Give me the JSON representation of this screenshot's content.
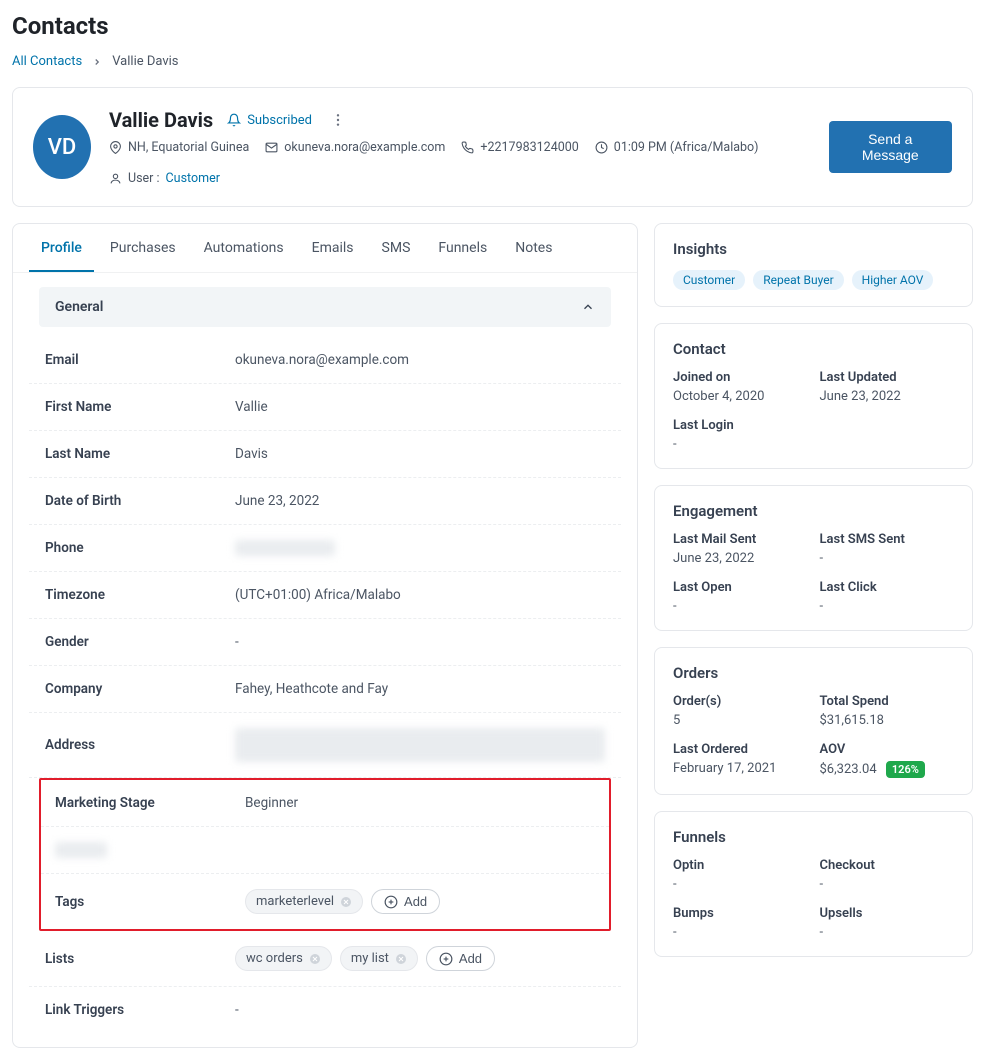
{
  "page_title": "Contacts",
  "breadcrumbs": {
    "all": "All Contacts",
    "current": "Vallie Davis"
  },
  "header": {
    "initials": "VD",
    "name": "Vallie Davis",
    "subscribe_label": "Subscribed",
    "location": "NH, Equatorial Guinea",
    "email": "okuneva.nora@example.com",
    "phone": "+2217983124000",
    "time": "01:09 PM (Africa/Malabo)",
    "user_prefix": "User :",
    "user_link": "Customer",
    "send_button": "Send a Message"
  },
  "tabs": [
    "Profile",
    "Purchases",
    "Automations",
    "Emails",
    "SMS",
    "Funnels",
    "Notes"
  ],
  "general": {
    "title": "General",
    "email_label": "Email",
    "email_value": "okuneva.nora@example.com",
    "first_name_label": "First Name",
    "first_name_value": "Vallie",
    "last_name_label": "Last Name",
    "last_name_value": "Davis",
    "dob_label": "Date of Birth",
    "dob_value": "June 23, 2022",
    "phone_label": "Phone",
    "phone_value": "+2217983124000",
    "timezone_label": "Timezone",
    "timezone_value": "(UTC+01:00) Africa/Malabo",
    "gender_label": "Gender",
    "gender_value": "-",
    "company_label": "Company",
    "company_value": "Fahey, Heathcote and Fay",
    "address_label": "Address",
    "address_value": "redacted",
    "marketing_label": "Marketing Stage",
    "marketing_value": "Beginner",
    "hidden_label": "redacted",
    "tags_label": "Tags",
    "tag_add": "Add",
    "tags": [
      "marketerlevel"
    ],
    "lists_label": "Lists",
    "lists": [
      "wc orders",
      "my list"
    ],
    "link_triggers_label": "Link Triggers",
    "link_triggers_value": "-"
  },
  "insights": {
    "title": "Insights",
    "badges": [
      "Customer",
      "Repeat Buyer",
      "Higher AOV"
    ]
  },
  "contact_info": {
    "title": "Contact",
    "joined_label": "Joined on",
    "joined_value": "October 4, 2020",
    "last_updated_label": "Last Updated",
    "last_updated_value": "June 23, 2022",
    "last_login_label": "Last Login",
    "last_login_value": "-"
  },
  "engagement": {
    "title": "Engagement",
    "mail_sent_label": "Last Mail Sent",
    "mail_sent_value": "June 23, 2022",
    "sms_sent_label": "Last SMS Sent",
    "sms_sent_value": "-",
    "last_open_label": "Last Open",
    "last_open_value": "-",
    "last_click_label": "Last Click",
    "last_click_value": "-"
  },
  "orders": {
    "title": "Orders",
    "orders_label": "Order(s)",
    "orders_value": "5",
    "spend_label": "Total Spend",
    "spend_value": "$31,615.18",
    "last_ordered_label": "Last Ordered",
    "last_ordered_value": "February 17, 2021",
    "aov_label": "AOV",
    "aov_value": "$6,323.04",
    "aov_pct": "126%"
  },
  "funnels": {
    "title": "Funnels",
    "optin_label": "Optin",
    "optin_value": "-",
    "checkout_label": "Checkout",
    "checkout_value": "-",
    "bumps_label": "Bumps",
    "bumps_value": "-",
    "upsells_label": "Upsells",
    "upsells_value": "-"
  }
}
